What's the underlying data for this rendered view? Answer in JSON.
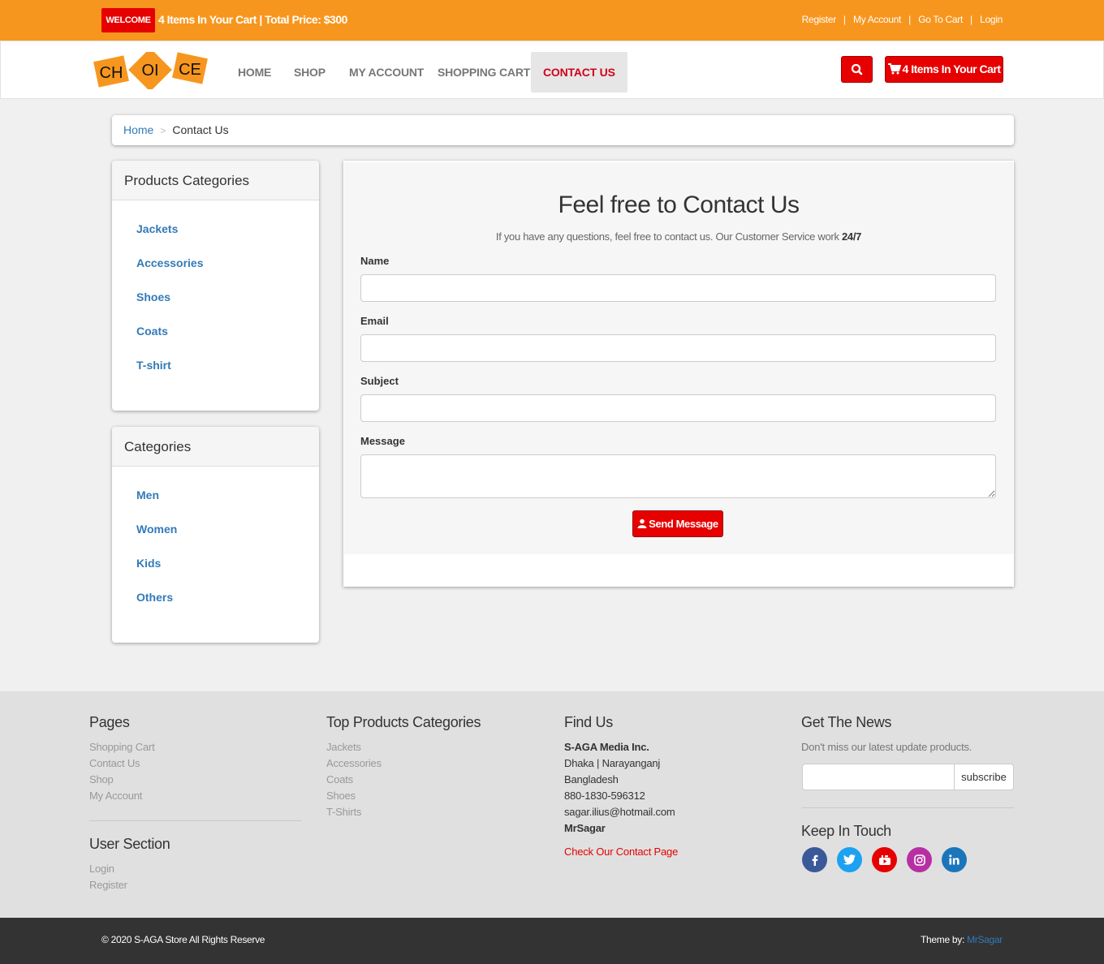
{
  "topbar": {
    "welcome": "WELCOME",
    "cart_summary": "4 Items In Your Cart | Total Price: $300",
    "links": [
      "Register",
      "My Account",
      "Go To Cart",
      "Login"
    ]
  },
  "logo": {
    "parts": [
      "CH",
      "OI",
      "CE"
    ]
  },
  "nav": {
    "items": [
      "HOME",
      "SHOP",
      "MY ACCOUNT",
      "SHOPPING CART",
      "CONTACT US"
    ],
    "active": "CONTACT US",
    "cart_button": "4 Items In Your Cart"
  },
  "breadcrumb": {
    "home": "Home",
    "current": "Contact Us"
  },
  "sidebar": {
    "products_title": "Products Categories",
    "products": [
      "Jackets",
      "Accessories",
      "Shoes",
      "Coats",
      "T-shirt"
    ],
    "categories_title": "Categories",
    "categories": [
      "Men",
      "Women",
      "Kids",
      "Others"
    ]
  },
  "contact": {
    "title": "Feel free to Contact Us",
    "subtitle_prefix": "If you have any questions, feel free to contact us. Our Customer Service work ",
    "subtitle_bold": "24/7",
    "fields": {
      "name": "Name",
      "email": "Email",
      "subject": "Subject",
      "message": "Message"
    },
    "send": "Send Message"
  },
  "footer": {
    "pages_title": "Pages",
    "pages": [
      "Shopping Cart",
      "Contact Us",
      "Shop",
      "My Account"
    ],
    "user_title": "User Section",
    "user_links": [
      "Login",
      "Register"
    ],
    "top_title": "Top Products Categories",
    "top_categories": [
      "Jackets",
      "Accessories",
      "Coats",
      "Shoes",
      "T-Shirts"
    ],
    "find_title": "Find Us",
    "company": "S-AGA Media Inc.",
    "address1": "Dhaka | Narayanganj",
    "address2": "Bangladesh",
    "phone": "880-1830-596312",
    "email": "sagar.ilius@hotmail.com",
    "owner": "MrSagar",
    "contact_link": "Check Our Contact Page",
    "news_title": "Get The News",
    "news_text": "Don't miss our latest update products.",
    "subscribe": "subscribe",
    "keep_title": "Keep In Touch",
    "social": [
      {
        "name": "facebook",
        "color": "#3b5998"
      },
      {
        "name": "twitter",
        "color": "#1da1f2"
      },
      {
        "name": "youtube",
        "color": "#e60000"
      },
      {
        "name": "instagram",
        "color": "#b730a3"
      },
      {
        "name": "linkedin",
        "color": "#1b75bb"
      }
    ]
  },
  "bottom": {
    "copyright": "© 2020 S-AGA Store All Rights Reserve",
    "theme_prefix": "Theme by:",
    "theme_author": "MrSagar"
  },
  "colors": {
    "orange": "#f7961e",
    "red": "#e60000",
    "link_blue": "#337ab7"
  }
}
